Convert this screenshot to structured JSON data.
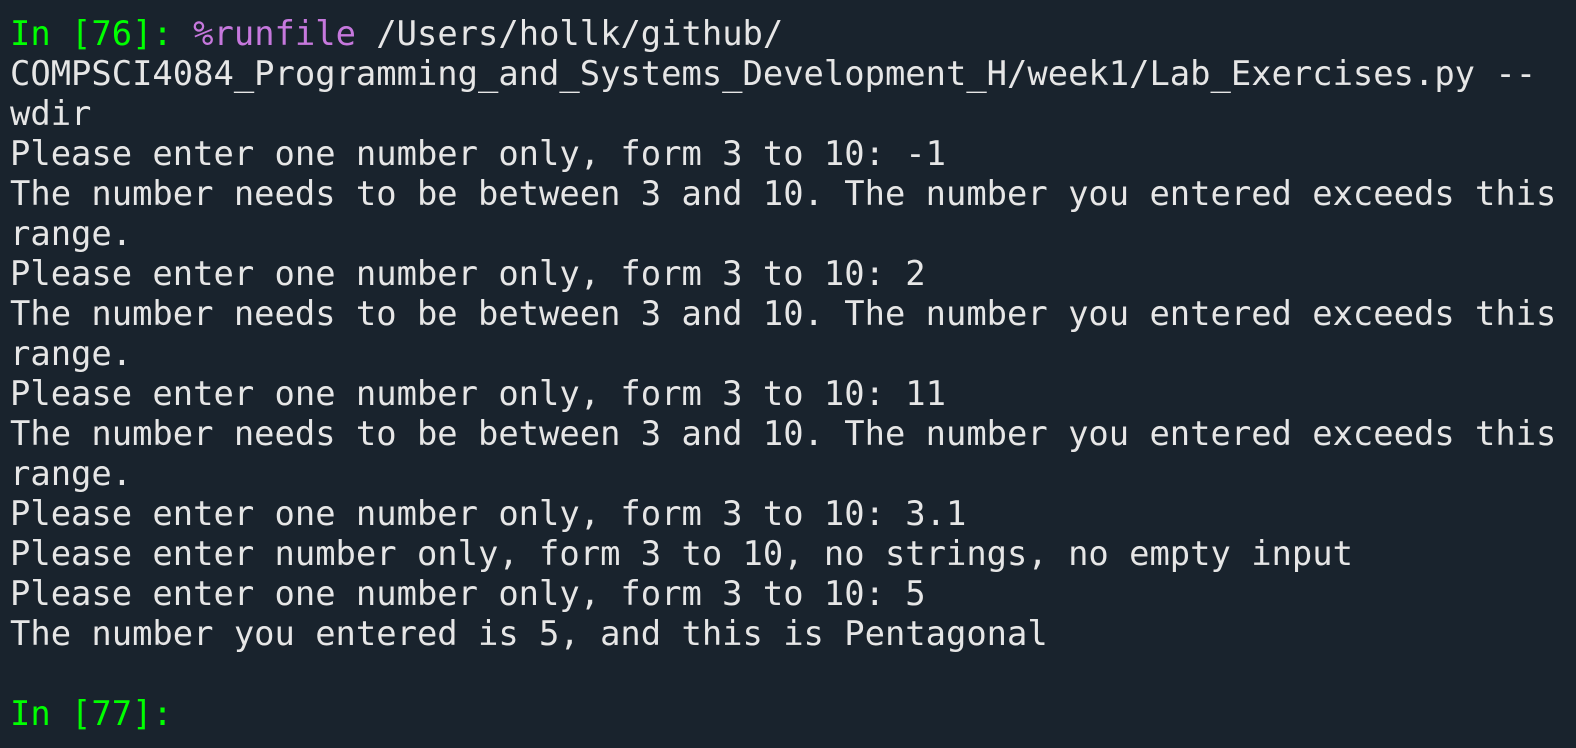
{
  "colors": {
    "background": "#19232d",
    "text": "#e6e6e6",
    "prompt": "#00ff00",
    "magic": "#c678dd"
  },
  "cell76": {
    "prompt": "In [76]: ",
    "magic_percent": "%",
    "magic_name": "runfile",
    "command_line1": " /Users/hollk/github/",
    "command_line2": "COMPSCI4084_Programming_and_Systems_Development_H/week1/Lab_Exercises.py --",
    "command_line3": "wdir"
  },
  "output": [
    "Please enter one number only, form 3 to 10: -1",
    "The number needs to be between 3 and 10. The number you entered exceeds this",
    "range.",
    "Please enter one number only, form 3 to 10: 2",
    "The number needs to be between 3 and 10. The number you entered exceeds this",
    "range.",
    "Please enter one number only, form 3 to 10: 11",
    "The number needs to be between 3 and 10. The number you entered exceeds this",
    "range.",
    "Please enter one number only, form 3 to 10: 3.1",
    "Please enter number only, form 3 to 10, no strings, no empty input",
    "Please enter one number only, form 3 to 10: 5",
    "The number you entered is 5, and this is Pentagonal"
  ],
  "cell77": {
    "prompt": "In [77]:"
  }
}
